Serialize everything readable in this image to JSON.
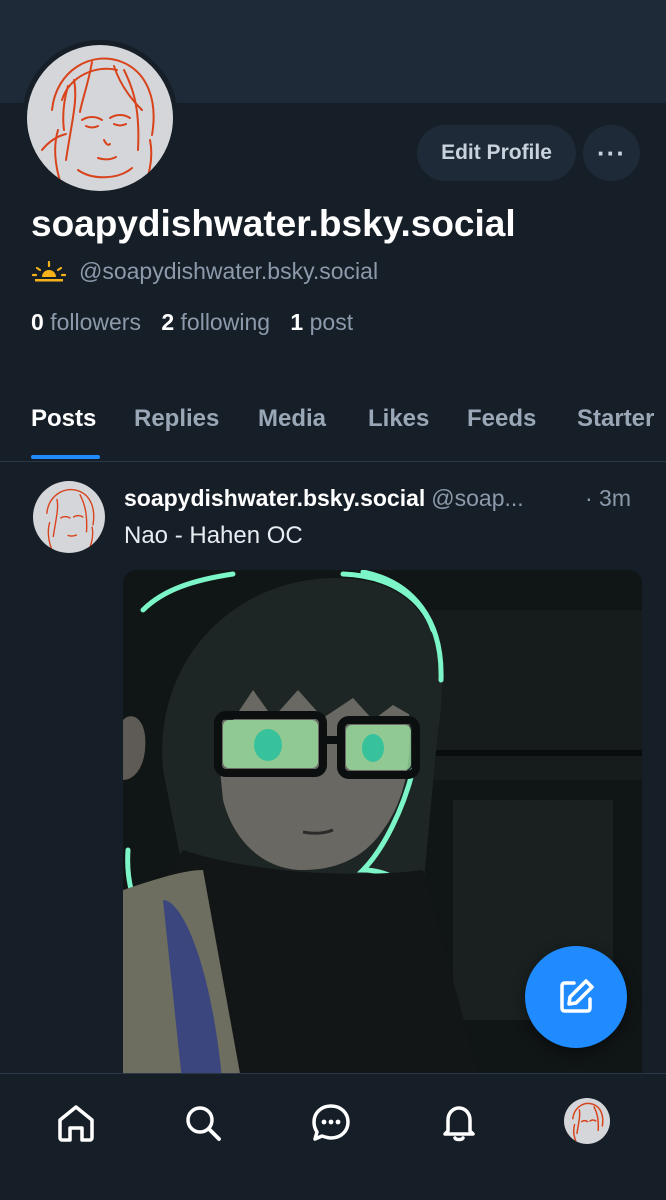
{
  "profile": {
    "display_name": "soapydishwater.bsky.social",
    "handle": "@soapydishwater.bsky.social",
    "avatar_icon": "sketch-portrait-avatar",
    "handle_icon": "sunrise-icon"
  },
  "actions": {
    "edit_label": "Edit Profile",
    "more_label": "···"
  },
  "stats": {
    "followers_count": "0",
    "followers_label": "followers",
    "following_count": "2",
    "following_label": "following",
    "posts_count": "1",
    "posts_label": "post"
  },
  "tabs": [
    {
      "label": "Posts",
      "active": true
    },
    {
      "label": "Replies"
    },
    {
      "label": "Media"
    },
    {
      "label": "Likes"
    },
    {
      "label": "Feeds"
    },
    {
      "label": "Starter"
    }
  ],
  "post": {
    "author": "soapydishwater.bsky.social",
    "handle": "@soap...",
    "time": "· 3m",
    "text": "Nao - Hahen OC",
    "image_icon": "anime-character-illustration"
  },
  "bottom_nav": [
    "home-icon",
    "search-icon",
    "chat-icon",
    "bell-icon",
    "profile-avatar"
  ],
  "colors": {
    "accent": "#208bfe",
    "background": "#161e27",
    "banner": "#1e2a37",
    "muted_text": "#8c9aab"
  }
}
